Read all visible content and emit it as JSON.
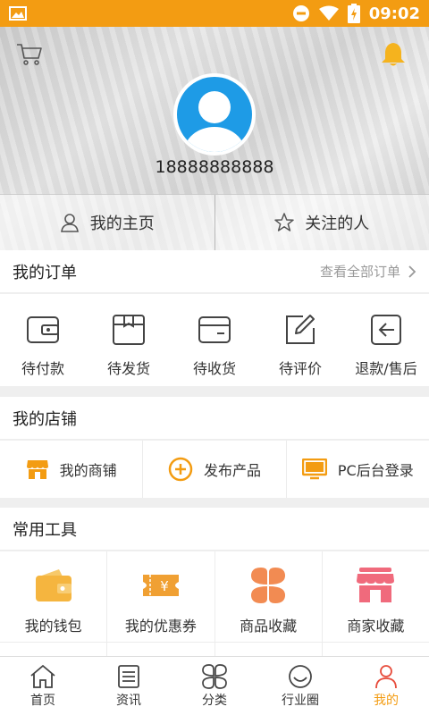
{
  "status_bar": {
    "time": "09:02",
    "bg_color": "#f39c12"
  },
  "profile": {
    "phone": "18888888888",
    "avatar_color": "#1e9be6"
  },
  "header_tabs": [
    {
      "label": "我的主页",
      "icon": "user-icon"
    },
    {
      "label": "关注的人",
      "icon": "star-icon"
    }
  ],
  "orders": {
    "title": "我的订单",
    "more_label": "查看全部订单",
    "items": [
      {
        "label": "待付款",
        "icon": "wallet-icon"
      },
      {
        "label": "待发货",
        "icon": "box-icon"
      },
      {
        "label": "待收货",
        "icon": "card-icon"
      },
      {
        "label": "待评价",
        "icon": "edit-icon"
      },
      {
        "label": "退款/售后",
        "icon": "return-icon"
      }
    ]
  },
  "shop": {
    "title": "我的店铺",
    "items": [
      {
        "label": "我的商铺",
        "icon": "store-icon"
      },
      {
        "label": "发布产品",
        "icon": "plus-circle-icon"
      },
      {
        "label": "PC后台登录",
        "icon": "monitor-icon"
      }
    ]
  },
  "tools": {
    "title": "常用工具",
    "items": [
      {
        "label": "我的钱包",
        "icon": "wallet-icon",
        "color": "#f5b53f"
      },
      {
        "label": "我的优惠券",
        "icon": "coupon-icon",
        "color": "#f0a033"
      },
      {
        "label": "商品收藏",
        "icon": "clover-icon",
        "color": "#f28b52"
      },
      {
        "label": "商家收藏",
        "icon": "shop-icon",
        "color": "#f06a7c"
      }
    ]
  },
  "tabbar": {
    "accent_color": "#f39c12",
    "items": [
      {
        "label": "首页",
        "icon": "home-icon",
        "active": false
      },
      {
        "label": "资讯",
        "icon": "news-icon",
        "active": false
      },
      {
        "label": "分类",
        "icon": "category-icon",
        "active": false
      },
      {
        "label": "行业圈",
        "icon": "smile-icon",
        "active": false
      },
      {
        "label": "我的",
        "icon": "profile-icon",
        "active": true
      }
    ]
  }
}
